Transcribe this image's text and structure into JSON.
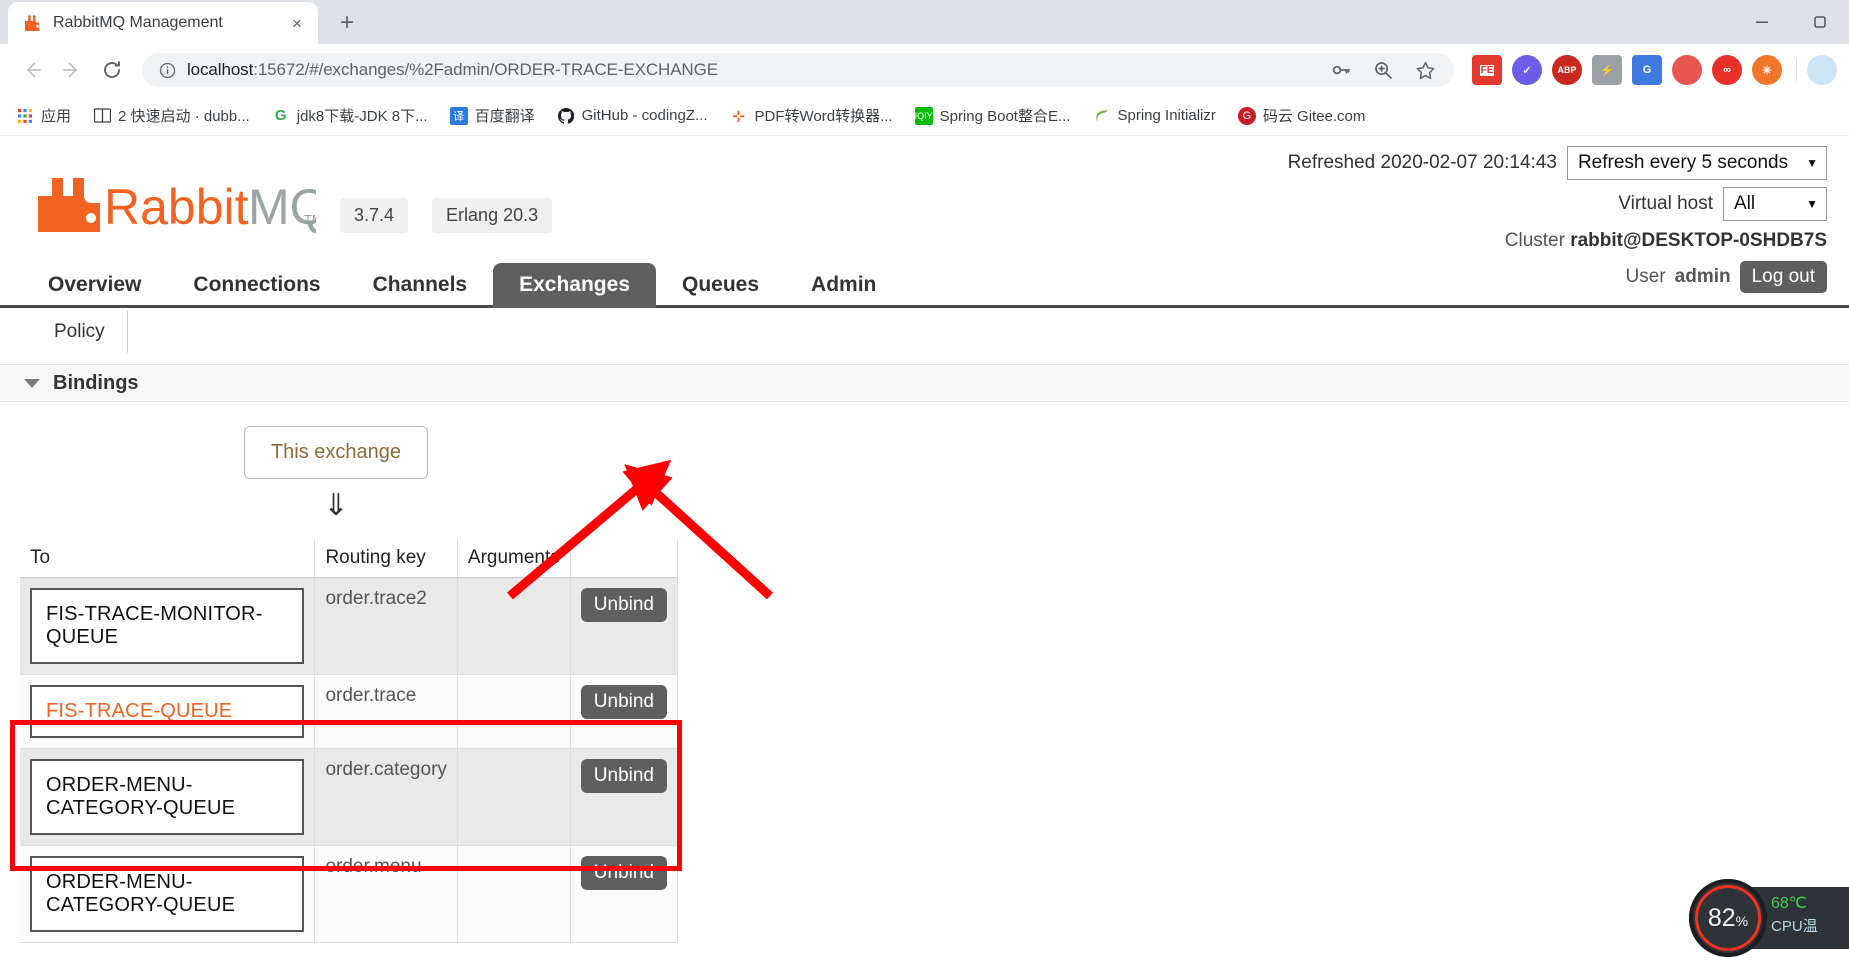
{
  "browser": {
    "tab": {
      "title": "RabbitMQ Management",
      "favicon": "rabbitmq-icon",
      "close": "×"
    },
    "new_tab_label": "+",
    "window_controls": {
      "minimize": "minimize-icon",
      "maximize": "maximize-icon"
    },
    "nav": {
      "back": "back-arrow-icon",
      "forward": "forward-arrow-icon",
      "reload": "reload-icon"
    },
    "omnibox": {
      "info_icon": "info-circle-icon",
      "url_host": "localhost",
      "url_rest": ":15672/#/exchanges/%2Fadmin/ORDER-TRACE-EXCHANGE",
      "icons": [
        "key-icon",
        "zoom-search-icon",
        "star-icon"
      ]
    },
    "extensions": [
      {
        "name": "fe-extension-icon",
        "label": "FE",
        "color": "#e23a2e"
      },
      {
        "name": "check-circle-extension-icon",
        "label": "✓",
        "color": "#6c5ce7"
      },
      {
        "name": "abp-extension-icon",
        "label": "ABP",
        "color": "#c8281f"
      },
      {
        "name": "flash-extension-icon",
        "label": "",
        "color": "#9aa0a6"
      },
      {
        "name": "google-translate-extension-icon",
        "label": "G",
        "color": "#3f7ae0"
      },
      {
        "name": "color-flower-extension-icon",
        "label": "",
        "color": "#e8554e"
      },
      {
        "name": "infinity-extension-icon",
        "label": "∞",
        "color": "#e8302a"
      },
      {
        "name": "orange-circle-extension-icon",
        "label": "",
        "color": "#f0762a"
      },
      {
        "name": "weather-extension-icon",
        "label": "",
        "color": "#cfe6f5"
      }
    ],
    "bookmarks": [
      {
        "label": "应用",
        "icon": "apps-grid-icon",
        "icon_color": "#4285f4"
      },
      {
        "label": "2 快速启动 · dubb...",
        "icon": "book-icon",
        "icon_color": "#3c4043"
      },
      {
        "label": "jdk8下载-JDK 8下...",
        "icon": "green-g-icon",
        "icon_color": "#34a853"
      },
      {
        "label": "百度翻译",
        "icon": "translate-icon",
        "icon_color": "#2b7ae5"
      },
      {
        "label": "GitHub - codingZ...",
        "icon": "github-icon",
        "icon_color": "#1b1f23"
      },
      {
        "label": "PDF转Word转换器...",
        "icon": "pdf-icon",
        "icon_color": "#f26322"
      },
      {
        "label": "Spring Boot整合E...",
        "icon": "iqiyi-icon",
        "icon_color": "#00be06"
      },
      {
        "label": "Spring Initializr",
        "icon": "spring-leaf-icon",
        "icon_color": "#6db33f"
      },
      {
        "label": "码云 Gitee.com",
        "icon": "gitee-icon",
        "icon_color": "#c71d23"
      }
    ]
  },
  "app": {
    "logo_text": "RabbitMQ",
    "badges": {
      "version": "3.7.4",
      "erlang": "Erlang 20.3"
    },
    "refreshed_text": "Refreshed 2020-02-07 20:14:43",
    "refresh_select": {
      "value": "Refresh every 5 seconds",
      "caret": "▼"
    },
    "vhost_label": "Virtual host",
    "vhost_select": {
      "value": "All",
      "caret": "▼"
    },
    "cluster_label": "Cluster",
    "cluster_value": "rabbit@DESKTOP-0SHDB7S",
    "user_label": "User",
    "user_value": "admin",
    "logout_label": "Log out",
    "nav_tabs": [
      {
        "label": "Overview",
        "active": false
      },
      {
        "label": "Connections",
        "active": false
      },
      {
        "label": "Channels",
        "active": false
      },
      {
        "label": "Exchanges",
        "active": true
      },
      {
        "label": "Queues",
        "active": false
      },
      {
        "label": "Admin",
        "active": false
      }
    ],
    "sub_nav": [
      {
        "label": "Policy"
      }
    ],
    "bindings_section": {
      "title": "Bindings",
      "exchange_box_label": "This exchange",
      "down_arrow": "⇓",
      "columns": [
        "To",
        "Routing key",
        "Arguments",
        ""
      ],
      "rows": [
        {
          "to": "FIS-TRACE-MONITOR-QUEUE",
          "routing_key": "order.trace2",
          "arguments": "",
          "action": "Unbind",
          "highlighted_link": false
        },
        {
          "to": "FIS-TRACE-QUEUE",
          "routing_key": "order.trace",
          "arguments": "",
          "action": "Unbind",
          "highlighted_link": true
        },
        {
          "to": "ORDER-MENU-CATEGORY-QUEUE",
          "routing_key": "order.category",
          "arguments": "",
          "action": "Unbind",
          "highlighted_link": false
        },
        {
          "to": "ORDER-MENU-CATEGORY-QUEUE",
          "routing_key": "order.menu",
          "arguments": "",
          "action": "Unbind",
          "highlighted_link": false
        }
      ]
    },
    "annotation_color": "#fe0000"
  },
  "cpu_widget": {
    "percent": "82",
    "percent_unit": "%",
    "temp": "68℃",
    "temp_label": "CPU温"
  }
}
